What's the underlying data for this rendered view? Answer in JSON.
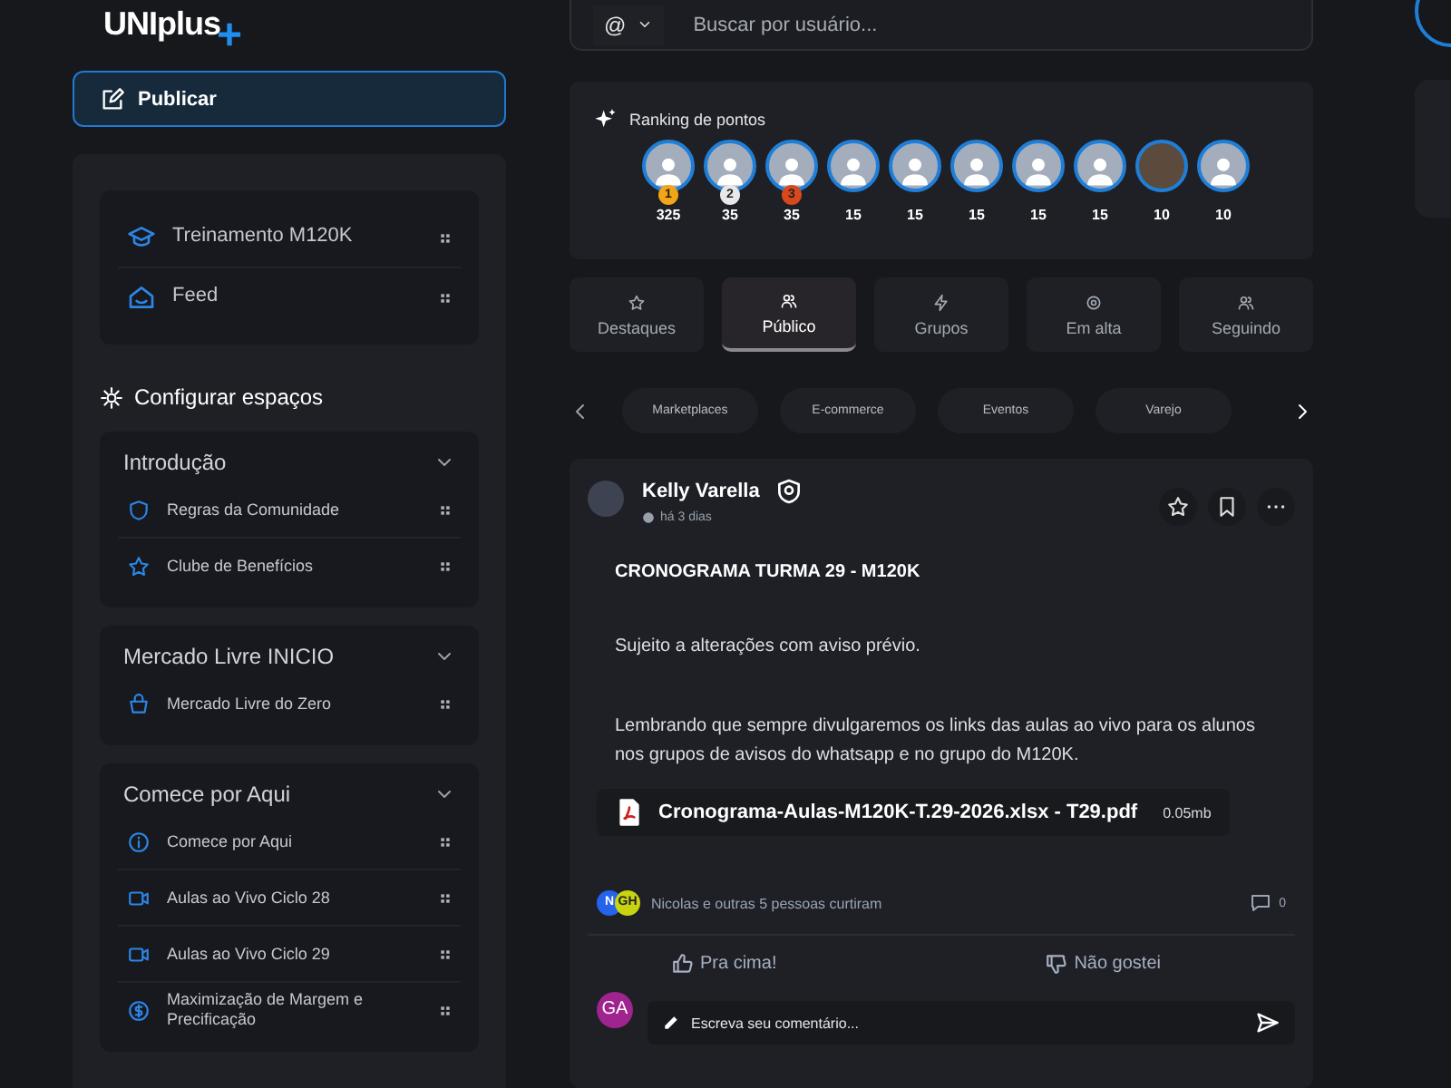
{
  "logo": {
    "text": "UNIplus",
    "mark": "+"
  },
  "publish_button": {
    "label": "Publicar"
  },
  "sidebar": {
    "pinned": [
      {
        "label": "Treinamento M120K",
        "kind": "graduation"
      },
      {
        "label": "Feed",
        "kind": "home"
      }
    ],
    "configure_label": "Configurar espaços",
    "sections": [
      {
        "title": "Introdução",
        "expanded": true,
        "items": [
          {
            "label": "Regras da Comunidade",
            "kind": "shield"
          },
          {
            "label": "Clube de Benefícios",
            "kind": "star"
          }
        ]
      },
      {
        "title": "Mercado Livre INICIO",
        "expanded": true,
        "items": [
          {
            "label": "Mercado Livre do Zero",
            "kind": "bag"
          }
        ]
      },
      {
        "title": "Comece por Aqui",
        "expanded": true,
        "items": [
          {
            "label": "Comece por Aqui",
            "kind": "info"
          },
          {
            "label": "Aulas ao Vivo Ciclo 28",
            "kind": "video"
          },
          {
            "label": "Aulas ao Vivo Ciclo 29",
            "kind": "video"
          },
          {
            "label": "Maximização de Margem e Precificação",
            "kind": "dollar"
          }
        ]
      }
    ]
  },
  "search": {
    "prefix": "@",
    "placeholder": "Buscar por usuário..."
  },
  "ranking": {
    "title": "Ranking de pontos",
    "users": [
      {
        "kind": "placeholder",
        "points": "325",
        "rank": "1",
        "color": "#f2a516"
      },
      {
        "kind": "placeholder",
        "points": "35",
        "rank": "2",
        "color": "#e8e8e8"
      },
      {
        "kind": "placeholder",
        "points": "35",
        "rank": "3",
        "color": "#d9481c"
      },
      {
        "kind": "placeholder",
        "points": "15"
      },
      {
        "kind": "placeholder",
        "points": "15"
      },
      {
        "kind": "placeholder",
        "points": "15"
      },
      {
        "kind": "placeholder",
        "points": "15"
      },
      {
        "kind": "placeholder",
        "points": "15"
      },
      {
        "kind": "photo",
        "points": "10"
      },
      {
        "kind": "placeholder",
        "points": "10"
      }
    ]
  },
  "tabs": [
    {
      "label": "Destaques",
      "kind": "star",
      "selected": false
    },
    {
      "label": "Público",
      "kind": "users",
      "selected": true
    },
    {
      "label": "Grupos",
      "kind": "bolt",
      "selected": false
    },
    {
      "label": "Em alta",
      "kind": "flame",
      "selected": false
    },
    {
      "label": "Seguindo",
      "kind": "users",
      "selected": false
    }
  ],
  "chips": [
    "Marketplaces",
    "E-commerce",
    "Eventos",
    "Varejo"
  ],
  "post": {
    "author": "Kelly Varella",
    "time": "há 3 dias",
    "title": "CRONOGRAMA TURMA 29 - M120K",
    "paragraphs": [
      "Sujeito a alterações com aviso prévio.",
      "Lembrando que sempre divulgaremos os links das aulas ao vivo para os alunos nos grupos de avisos do whatsapp e no grupo do M120K."
    ],
    "attachment": {
      "name": "Cronograma-Aulas-M120K-T.29-2026.xlsx - T29.pdf",
      "size": "0.05mb"
    },
    "likers": [
      {
        "initials": "N",
        "color": "#2563eb"
      },
      {
        "initials": "GH",
        "color": "#c8d411"
      }
    ],
    "likes_text": "Nicolas e outras 5 pessoas curtiram",
    "comment_count": "0",
    "actions": [
      {
        "label": "Pra cima!",
        "kind": "thumb-up"
      },
      {
        "label": "Não gostei",
        "kind": "thumb-down"
      }
    ],
    "commenter": {
      "initials": "GA",
      "color": "#a0248f"
    },
    "comment_placeholder": "Escreva seu comentário..."
  }
}
